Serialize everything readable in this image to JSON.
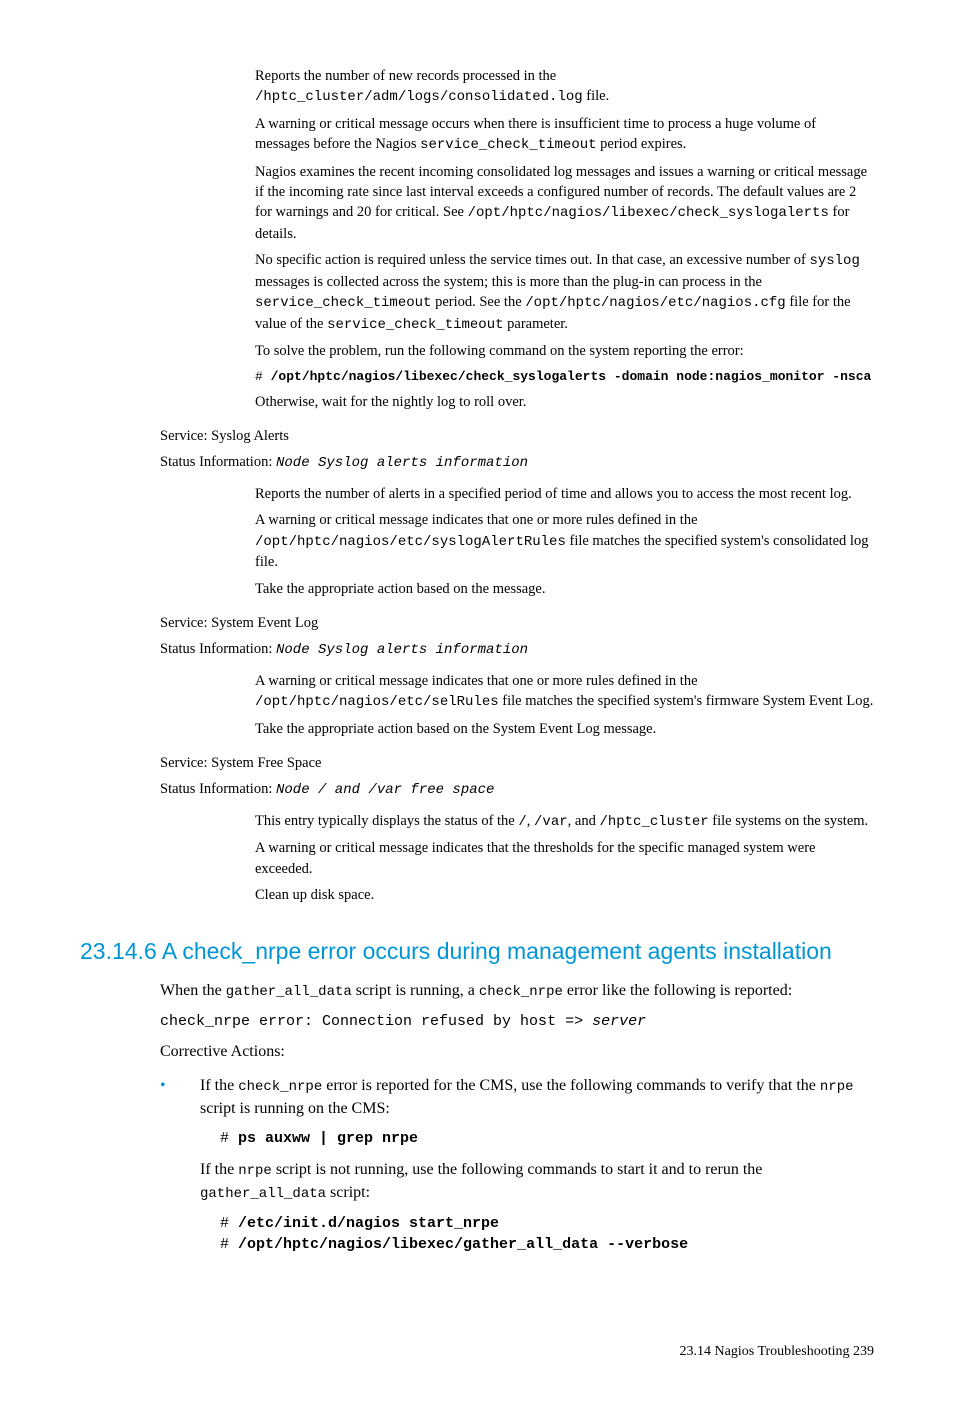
{
  "sec1": {
    "p1a": "Reports the number of new records processed in the ",
    "p1m": "/hptc_cluster/adm/logs/consolidated.log",
    "p1b": " file.",
    "p2a": "A warning or critical message occurs when there is insufficient time to process a huge volume of messages before the Nagios ",
    "p2m": "service_check_timeout",
    "p2b": " period expires.",
    "p3a": "Nagios examines the recent incoming consolidated log messages and issues a warning or critical message if the incoming rate since last interval exceeds a configured number of records. The default values are 2 for warnings and 20 for critical. See ",
    "p3m": "/opt/hptc/nagios/libexec/check_syslogalerts",
    "p3b": " for details.",
    "p4a": "No specific action is required unless the service times out. In that case, an excessive number of ",
    "p4m1": "syslog",
    "p4b": " messages is collected across the system; this is more than the plug-in can process in the ",
    "p4m2": "service_check_timeout",
    "p4c": " period. See the ",
    "p4m3": "/opt/hptc/nagios/etc/nagios.cfg",
    "p4d": " file for the value of the ",
    "p4m4": "service_check_timeout",
    "p4e": " parameter.",
    "p5": "To solve the problem, run the following command on the system reporting the error:",
    "cmd1_h": "# ",
    "cmd1": "/opt/hptc/nagios/libexec/check_syslogalerts -domain node:nagios_monitor -nsca",
    "p6": "Otherwise, wait for the nightly log to roll over."
  },
  "svc2": {
    "label": "Service: Syslog Alerts",
    "status_a": "Status Information: ",
    "status_m": "Node Syslog alerts information",
    "p1": "Reports the number of alerts in a specified period of time and allows you to access the most recent log.",
    "p2a": "A warning or critical message indicates that one or more rules defined in the ",
    "p2m": "/opt/hptc/nagios/etc/syslogAlertRules",
    "p2b": " file matches the specified system's consolidated log file.",
    "p3": "Take the appropriate action based on the message."
  },
  "svc3": {
    "label": "Service: System Event Log",
    "status_a": "Status Information: ",
    "status_m": "Node Syslog alerts information",
    "p1a": "A warning or critical message indicates that one or more rules defined in the ",
    "p1m": "/opt/hptc/nagios/etc/selRules",
    "p1b": " file matches the specified system's firmware System Event Log.",
    "p2": "Take the appropriate action based on the System Event Log message."
  },
  "svc4": {
    "label": "Service: System Free Space",
    "status_a": "Status Information: ",
    "status_m": "Node / and /var free space",
    "p1a": "This entry typically displays the status of the ",
    "p1m1": "/",
    "p1b": ", ",
    "p1m2": "/var",
    "p1c": ", and ",
    "p1m3": "/hptc_cluster",
    "p1d": " file systems on the system.",
    "p2": "A warning or critical message indicates that the thresholds for the specific managed system were exceeded.",
    "p3": "Clean up disk space."
  },
  "heading": "23.14.6 A check_nrpe error occurs during management agents installation",
  "body": {
    "p1a": "When the ",
    "p1m1": "gather_all_data",
    "p1b": " script is running, a ",
    "p1m2": "check_nrpe",
    "p1c": " error like the following is reported:",
    "err_a": "check_nrpe error: Connection refused by host => ",
    "err_b": "server",
    "p2": "Corrective Actions:",
    "b1a": "If the ",
    "b1m1": "check_nrpe",
    "b1b": " error is reported for the CMS, use the following commands to verify that the ",
    "b1m2": "nrpe",
    "b1c": " script is running on the CMS:",
    "cmd_h": "# ",
    "cmd1": "ps auxww | grep nrpe",
    "b1d": "If the ",
    "b1m3": "nrpe",
    "b1e": " script is not running, use the following commands to start it and to rerun the ",
    "b1m4": "gather_all_data",
    "b1f": " script:",
    "cmd2": "/etc/init.d/nagios start_nrpe",
    "cmd3": "/opt/hptc/nagios/libexec/gather_all_data --verbose"
  },
  "footer": "23.14 Nagios Troubleshooting    239"
}
